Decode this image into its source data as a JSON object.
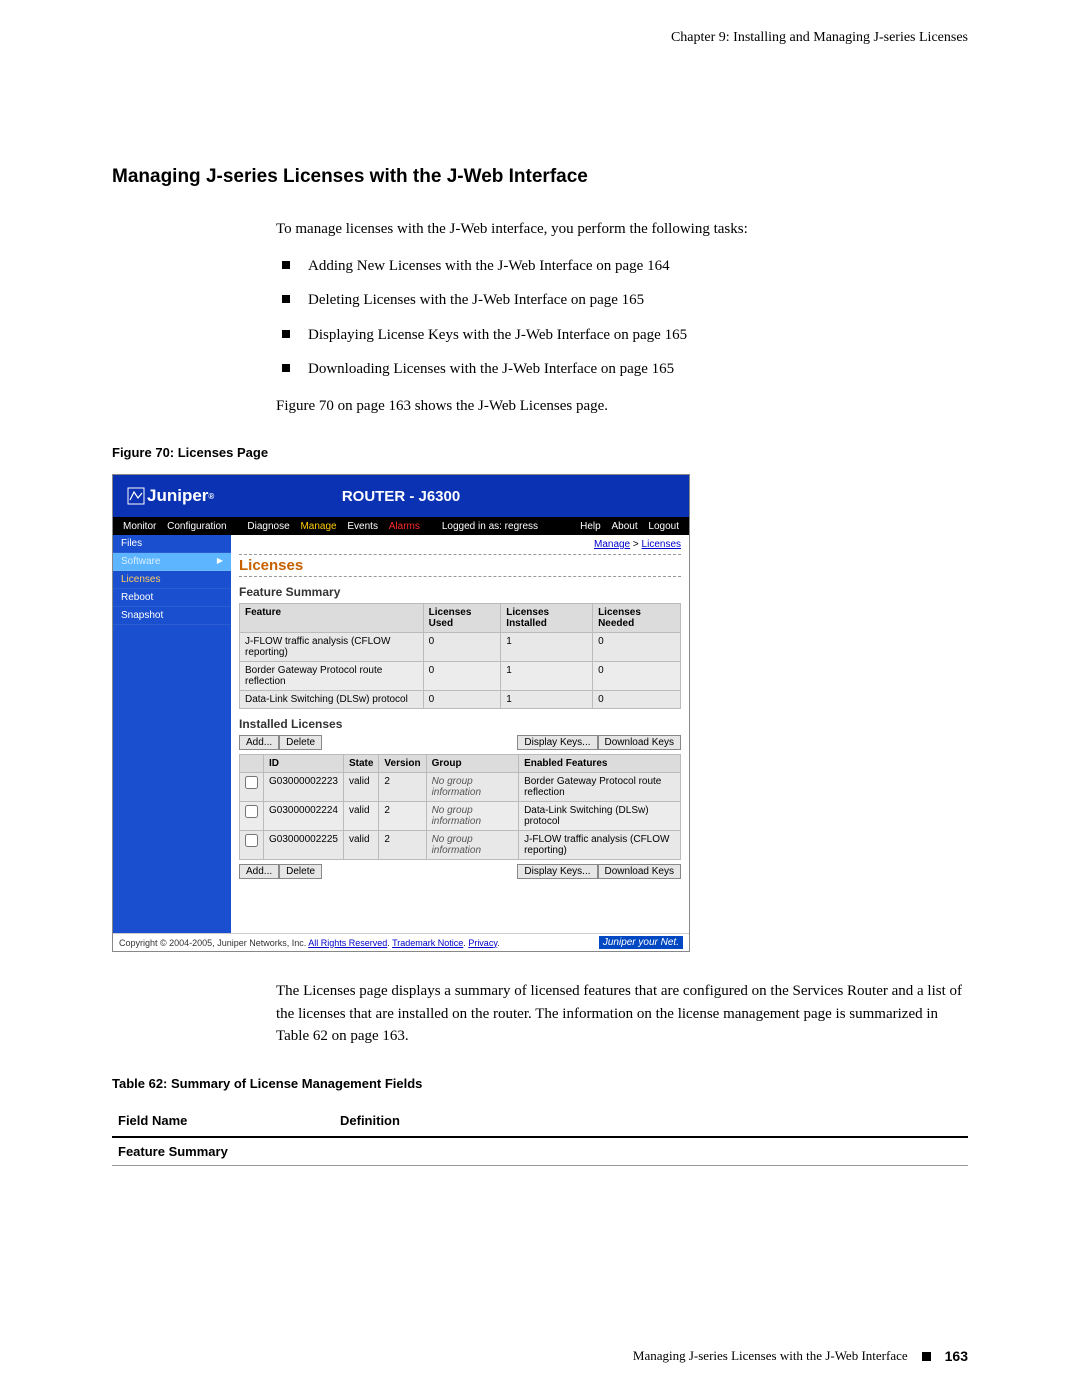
{
  "chapter_header": "Chapter 9: Installing and Managing J-series Licenses",
  "section_title": "Managing J-series Licenses with the J-Web Interface",
  "intro": "To manage licenses with the J-Web interface, you perform the following tasks:",
  "tasks": [
    "Adding New Licenses with the J-Web Interface on page 164",
    "Deleting Licenses with the J-Web Interface on page 165",
    "Displaying License Keys with the J-Web Interface on page 165",
    "Downloading Licenses with the J-Web Interface on page 165"
  ],
  "figure_ref": "Figure 70 on page 163 shows the J-Web Licenses page.",
  "figure_caption": "Figure 70: Licenses Page",
  "screenshot": {
    "brand": "Juniper",
    "router_title": "ROUTER - J6300",
    "menubar": {
      "tabs": [
        "Monitor",
        "Configuration",
        "Diagnose",
        "Manage",
        "Events",
        "Alarms"
      ],
      "logged_in": "Logged in as: regress",
      "right": [
        "Help",
        "About",
        "Logout"
      ]
    },
    "sidebar": [
      "Files",
      "Software",
      "Licenses",
      "Reboot",
      "Snapshot"
    ],
    "breadcrumb_manage": "Manage",
    "breadcrumb_sep": " > ",
    "breadcrumb_page": "Licenses",
    "page_title": "Licenses",
    "feature_summary_heading": "Feature Summary",
    "summary_headers": [
      "Feature",
      "Licenses Used",
      "Licenses Installed",
      "Licenses Needed"
    ],
    "summary_rows": [
      {
        "feature": "J-FLOW traffic analysis (CFLOW reporting)",
        "used": "0",
        "installed": "1",
        "needed": "0"
      },
      {
        "feature": "Border Gateway Protocol route reflection",
        "used": "0",
        "installed": "1",
        "needed": "0"
      },
      {
        "feature": "Data-Link Switching (DLSw) protocol",
        "used": "0",
        "installed": "1",
        "needed": "0"
      }
    ],
    "installed_heading": "Installed Licenses",
    "buttons": {
      "add": "Add...",
      "delete": "Delete",
      "display": "Display Keys...",
      "download": "Download Keys"
    },
    "installed_headers": [
      "",
      "ID",
      "State",
      "Version",
      "Group",
      "Enabled Features"
    ],
    "installed_rows": [
      {
        "id": "G03000002223",
        "state": "valid",
        "ver": "2",
        "group": "No group information",
        "feat": "Border Gateway Protocol route reflection"
      },
      {
        "id": "G03000002224",
        "state": "valid",
        "ver": "2",
        "group": "No group information",
        "feat": "Data-Link Switching (DLSw) protocol"
      },
      {
        "id": "G03000002225",
        "state": "valid",
        "ver": "2",
        "group": "No group information",
        "feat": "J-FLOW traffic analysis (CFLOW reporting)"
      }
    ],
    "footer_copyright": "Copyright © 2004-2005, Juniper Networks, Inc. ",
    "footer_links": [
      "All Rights Reserved",
      "Trademark Notice",
      "Privacy"
    ],
    "footer_slogan": "Juniper your Net."
  },
  "after_figure": "The Licenses page displays a summary of licensed features that are configured on the Services Router and a list of the licenses that are installed on the router. The information on the license management page is summarized in Table 62 on page 163.",
  "table_caption": "Table 62: Summary of License Management Fields",
  "fields_table": {
    "headers": [
      "Field Name",
      "Definition"
    ],
    "row1": "Feature Summary"
  },
  "page_footer_text": "Managing J-series Licenses with the J-Web Interface",
  "page_number": "163"
}
